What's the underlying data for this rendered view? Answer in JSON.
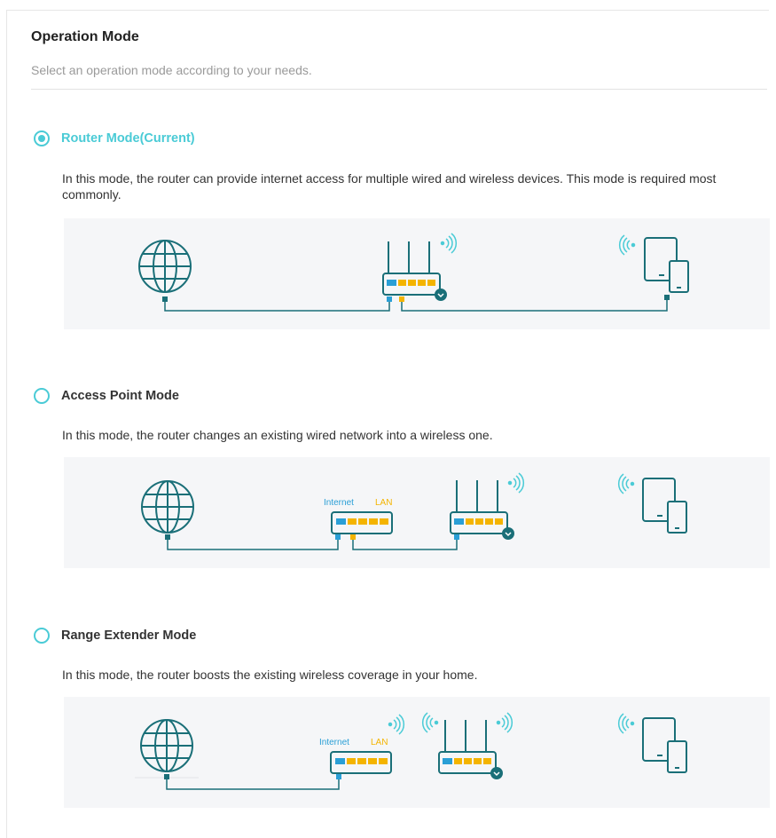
{
  "page": {
    "title": "Operation Mode",
    "description": "Select an operation mode according to your needs."
  },
  "modes": [
    {
      "label": "Router Mode(Current)",
      "selected": true,
      "description": "In this mode, the router can provide internet access for multiple wired and wireless devices. This mode is required most commonly."
    },
    {
      "label": "Access Point Mode",
      "selected": false,
      "description": "In this mode, the router changes an existing wired network into a wireless one.",
      "port_labels": {
        "internet": "Internet",
        "lan": "LAN"
      }
    },
    {
      "label": "Range Extender Mode",
      "selected": false,
      "description": "In this mode, the router boosts the existing wireless coverage in your home.",
      "port_labels": {
        "internet": "Internet",
        "lan": "LAN"
      }
    }
  ],
  "colors": {
    "accent": "#4acbd6",
    "line": "#1a6f78",
    "internet_port": "#2a9fd6",
    "lan_port": "#f4b400",
    "diagram_bg": "#f5f6f8"
  },
  "icons": [
    "globe-icon",
    "router-icon",
    "modem-icon",
    "wifi-signal-icon",
    "tablet-phone-icon"
  ]
}
